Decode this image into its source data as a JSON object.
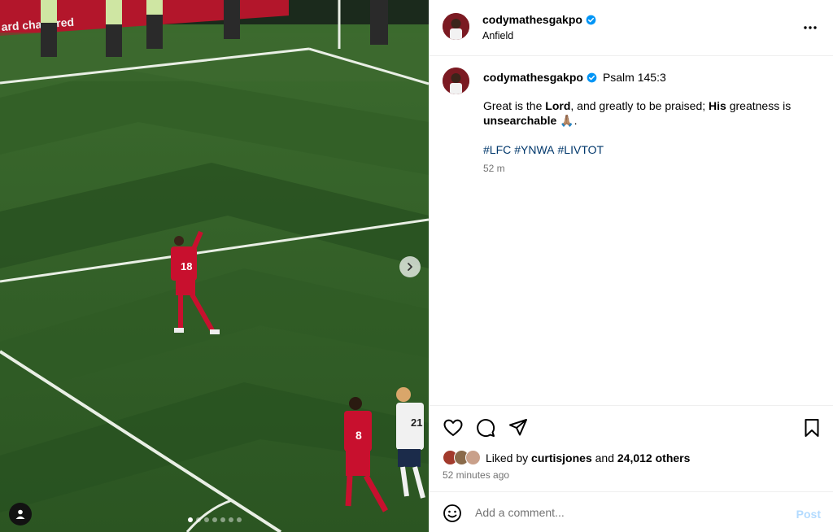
{
  "post": {
    "username": "codymathesgakpo",
    "location": "Anfield",
    "caption_ref": "Psalm 145:3",
    "caption_parts": {
      "p1": "Great is the ",
      "p2": "Lord",
      "p3": ", and greatly to be praised; ",
      "p4": "His",
      "p5": " greatness is ",
      "p6": "unsearchable",
      "p7": " 🙏🏽."
    },
    "hashtags": [
      "#LFC",
      "#YNWA",
      "#LIVTOT"
    ],
    "caption_time": "52 m",
    "photo_count": 7,
    "active_photo": 1,
    "banner_text": "ard chartered"
  },
  "likes": {
    "prefix": "Liked by",
    "user": "curtisjones",
    "connector": "and",
    "others": "24,012 others"
  },
  "time_ago": "52 minutes ago",
  "comment": {
    "placeholder": "Add a comment...",
    "post_label": "Post"
  },
  "icons": {
    "more": "more-options-icon",
    "like": "heart-icon",
    "comment": "comment-icon",
    "share": "share-icon",
    "save": "bookmark-icon",
    "emoji": "emoji-icon",
    "next": "chevron-right-icon",
    "tag": "user-tag-icon",
    "verified": "verified-badge-icon"
  },
  "colors": {
    "verified_blue": "#0095f6",
    "hashtag": "#00376b",
    "muted": "#737373",
    "post_disabled": "#b3dbff",
    "kit_red": "#c8102e"
  }
}
